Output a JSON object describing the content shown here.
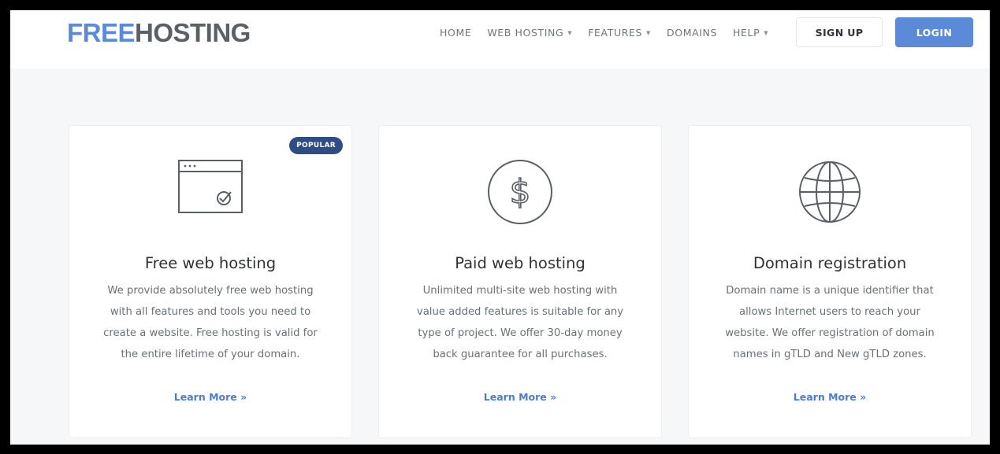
{
  "brand": {
    "part1": "FREE",
    "part2": "HOSTING",
    "primary_color": "#5b8ad9",
    "dark_color": "#5a6066"
  },
  "nav": {
    "items": [
      {
        "label": "HOME",
        "dropdown": false
      },
      {
        "label": "WEB HOSTING",
        "dropdown": true
      },
      {
        "label": "FEATURES",
        "dropdown": true
      },
      {
        "label": "DOMAINS",
        "dropdown": false
      },
      {
        "label": "HELP",
        "dropdown": true
      }
    ],
    "signup_label": "SIGN UP",
    "login_label": "LOGIN"
  },
  "cards": [
    {
      "icon": "browser-check-icon",
      "badge": "POPULAR",
      "title": "Free web hosting",
      "lines": [
        "We provide absolutely free web hosting",
        "with all features and tools you need to",
        "create a website. Free hosting is valid for",
        "the entire lifetime of your domain."
      ],
      "link": "Learn More »"
    },
    {
      "icon": "dollar-icon",
      "title": "Paid web hosting",
      "lines": [
        "Unlimited multi-site web hosting with",
        "value added features is suitable for any",
        "type of project. We offer 30-day money",
        "back guarantee for all purchases."
      ],
      "link": "Learn More »"
    },
    {
      "icon": "globe-icon",
      "title": "Domain registration",
      "lines": [
        "Domain name is a unique identifier that",
        "allows Internet users to reach your",
        "website. We offer registration of domain",
        "names in gTLD and New gTLD zones."
      ],
      "link": "Learn More »"
    }
  ],
  "colors": {
    "badge": "#2f4d85",
    "link": "#4a7ccc",
    "page_bg": "#f6f7f9"
  }
}
